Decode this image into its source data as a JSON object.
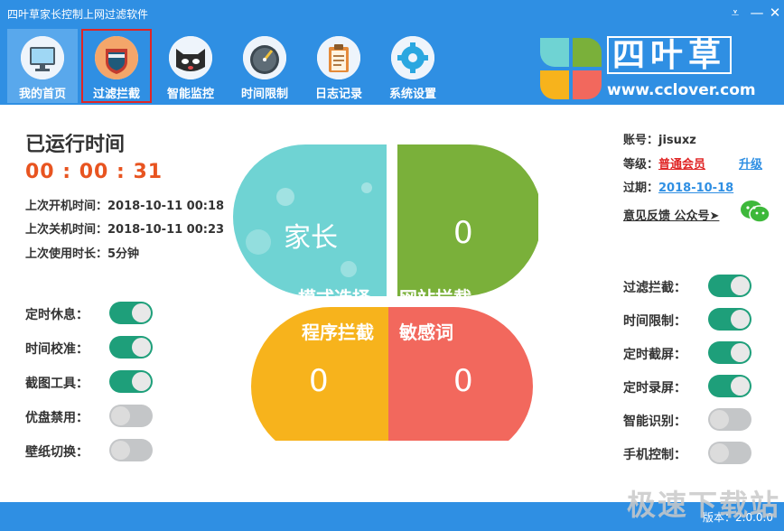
{
  "window": {
    "title": "四叶草家长控制上网过滤软件"
  },
  "nav": [
    {
      "label": "我的首页",
      "icon": "monitor-icon"
    },
    {
      "label": "过滤拦截",
      "icon": "shield-icon"
    },
    {
      "label": "智能监控",
      "icon": "cat-face-icon"
    },
    {
      "label": "时间限制",
      "icon": "gauge-icon"
    },
    {
      "label": "日志记录",
      "icon": "clipboard-icon"
    },
    {
      "label": "系统设置",
      "icon": "gear-icon"
    }
  ],
  "logo": {
    "text": "四叶草",
    "url": "www.cclover.com"
  },
  "runtime": {
    "label": "已运行时间",
    "value": "00 : 00 : 31"
  },
  "info": {
    "boot": "上次开机时间：2018-10-11 00:18",
    "shutdown": "上次关机时间：2018-10-11 00:23",
    "duration": "上次使用时长：5分钟"
  },
  "left_switches": [
    {
      "label": "定时休息：",
      "on": true
    },
    {
      "label": "时间校准：",
      "on": true
    },
    {
      "label": "截图工具：",
      "on": true
    },
    {
      "label": "优盘禁用：",
      "on": false
    },
    {
      "label": "壁纸切换：",
      "on": false
    }
  ],
  "right_switches": [
    {
      "label": "过滤拦截：",
      "on": true
    },
    {
      "label": "时间限制：",
      "on": true
    },
    {
      "label": "定时截屏：",
      "on": true
    },
    {
      "label": "定时录屏：",
      "on": true
    },
    {
      "label": "智能识别：",
      "on": false
    },
    {
      "label": "手机控制：",
      "on": false
    }
  ],
  "account": {
    "account_label": "账号：",
    "account_value": "jisuxz",
    "level_label": "等级：",
    "level_value": "普通会员",
    "upgrade": "升级",
    "expire_label": "过期：",
    "expire_value": "2018-10-18",
    "feedback": "意见反馈 公众号➤"
  },
  "clover": {
    "top_left": "家长",
    "top_right": "0",
    "bottom_left": "0",
    "bottom_right": "0",
    "mode_select": "模式选择",
    "site_block": "网站拦截",
    "program_block": "程序拦截",
    "sensitive_words": "敏感词"
  },
  "status": {
    "version": "版本：2.0.0.0",
    "watermark": "极速下载站"
  },
  "colors": {
    "accent": "#2f8fe3",
    "teal": "#6fd3d3",
    "green": "#7ab03a",
    "orange": "#f7b31c",
    "red": "#f2685d",
    "switch_on": "#1e9f7a"
  }
}
